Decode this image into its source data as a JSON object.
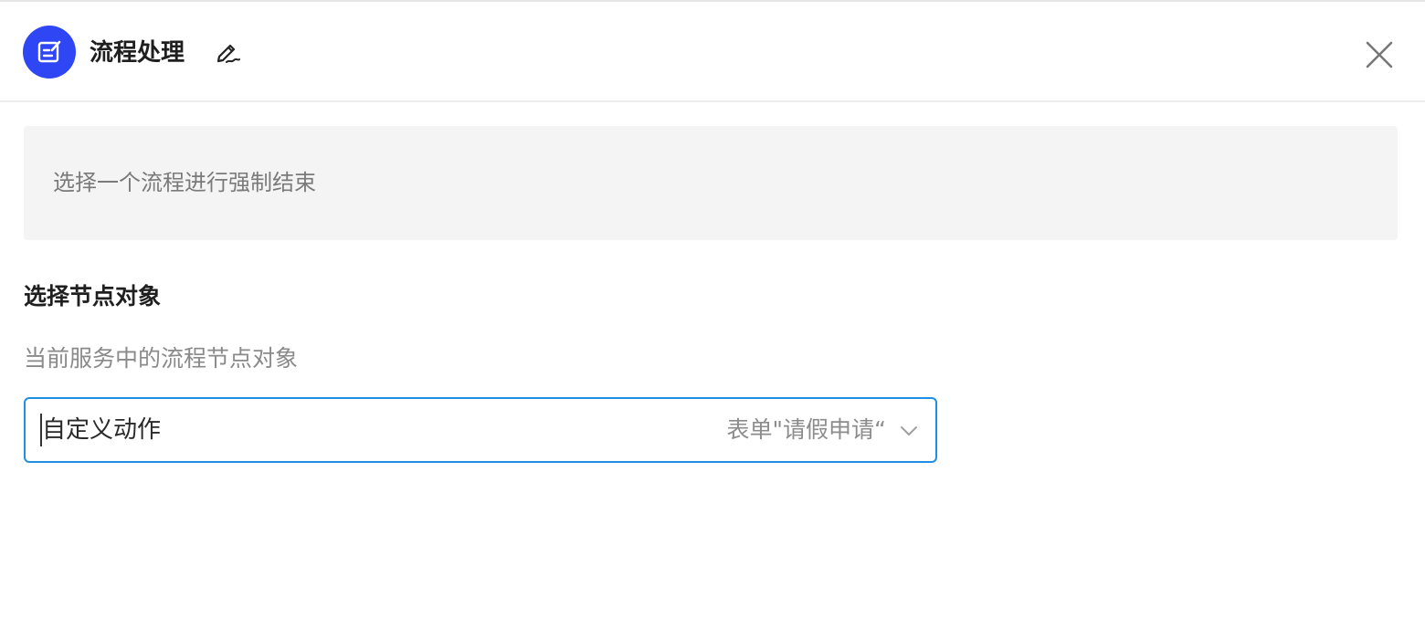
{
  "header": {
    "title": "流程处理",
    "icons": {
      "app": "edit-document-icon",
      "edit": "pen-icon",
      "close": "close-icon"
    },
    "app_icon_color": "#2f46f5"
  },
  "info": {
    "text": "选择一个流程进行强制结束"
  },
  "section": {
    "title": "选择节点对象",
    "description": "当前服务中的流程节点对象"
  },
  "select": {
    "value": "自定义动作",
    "hint": "表单\"请假申请“",
    "icon": "chevron-down-icon",
    "border_color": "#1f8fe6"
  }
}
